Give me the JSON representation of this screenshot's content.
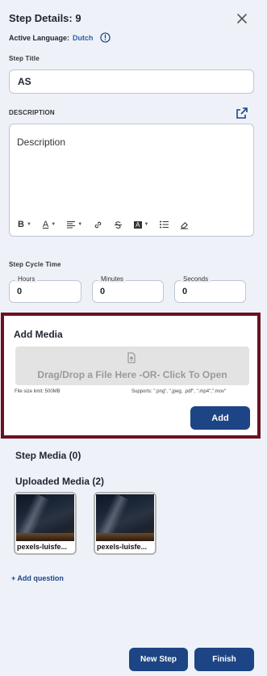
{
  "header": {
    "title": "Step Details: 9",
    "active_language_label": "Active Language:",
    "active_language_value": "Dutch",
    "close_icon": "close-icon",
    "info_icon": "info-icon"
  },
  "step_title": {
    "label": "Step Title",
    "value": "AS"
  },
  "description": {
    "label": "DESCRIPTION",
    "placeholder": "Description",
    "expand_icon": "external-link-icon",
    "toolbar": [
      "bold",
      "text-color",
      "align",
      "link",
      "strikethrough",
      "font-style",
      "bullet-list",
      "clear-format"
    ],
    "toolbar_glyphs": {
      "bold": "B",
      "text_color": "A",
      "font_style": "A"
    }
  },
  "cycle_time": {
    "label": "Step Cycle Time",
    "hours_label": "Hours",
    "hours_value": "0",
    "minutes_label": "Minutes",
    "minutes_value": "0",
    "seconds_label": "Seconds",
    "seconds_value": "0"
  },
  "add_media": {
    "title": "Add Media",
    "drop_text": "Drag/Drop a File Here -OR- Click To Open",
    "size_limit": "File size limit: 500MB",
    "supports": "Supports: \".png\", \".jpeg, .pdf\", \".mp4\",\".mov\"",
    "add_label": "Add"
  },
  "step_media": {
    "title": "Step Media (0)"
  },
  "uploaded_media": {
    "title": "Uploaded Media (2)",
    "items": [
      {
        "name": "pexels-luisfe..."
      },
      {
        "name": "pexels-luisfe..."
      }
    ]
  },
  "add_question_label": "+  Add question",
  "footer": {
    "new_step_label": "New Step",
    "finish_label": "Finish"
  },
  "colors": {
    "accent": "#1d4585",
    "highlight_border": "#6b1120",
    "background": "#eef2f8"
  }
}
